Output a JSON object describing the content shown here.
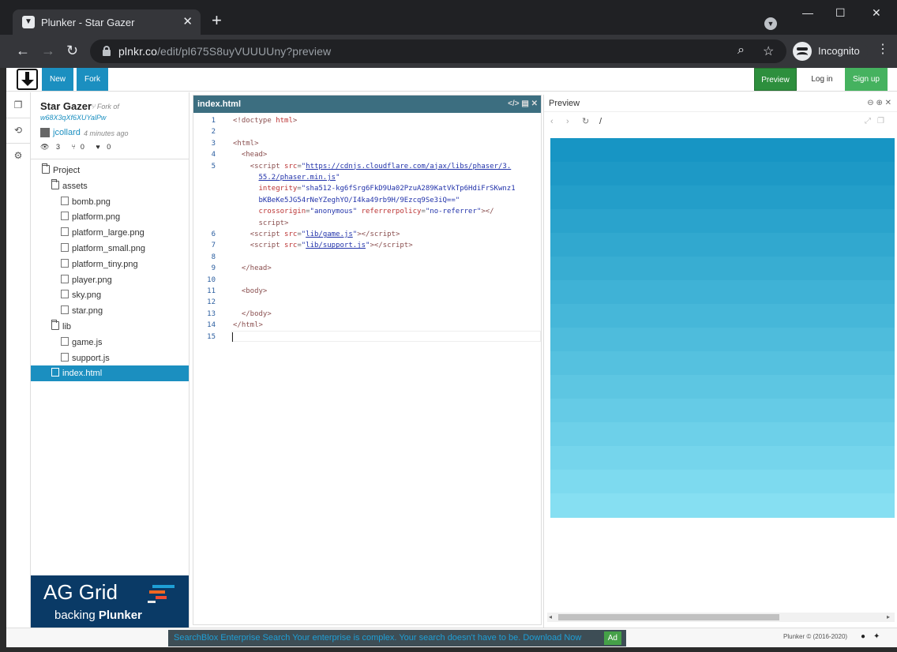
{
  "browser": {
    "tab_title": "Plunker - Star Gazer",
    "tab_close": "✕",
    "new_tab": "+",
    "url_host": "plnkr.co",
    "url_path": "/edit/pl675S8uyVUUUUny?preview",
    "profile_label": "Incognito",
    "win_min": "—",
    "win_max": "☐",
    "win_close": "✕"
  },
  "toolbar": {
    "new_label": "New",
    "fork_label": "Fork",
    "preview_label": "Preview",
    "login_label": "Log in",
    "signup_label": "Sign up"
  },
  "plunk": {
    "title": "Star Gazer",
    "fork_of": "Fork of",
    "fork_id": "w68X3qXf6XUYalPw",
    "user": "jcollard",
    "time": "4 minutes ago",
    "views": "3",
    "forks": "0",
    "stars": "0"
  },
  "tree": [
    {
      "label": "Project",
      "type": "folder",
      "depth": 0
    },
    {
      "label": "assets",
      "type": "folder",
      "depth": 1
    },
    {
      "label": "bomb.png",
      "type": "file",
      "depth": 2
    },
    {
      "label": "platform.png",
      "type": "file",
      "depth": 2
    },
    {
      "label": "platform_large.png",
      "type": "file",
      "depth": 2
    },
    {
      "label": "platform_small.png",
      "type": "file",
      "depth": 2
    },
    {
      "label": "platform_tiny.png",
      "type": "file",
      "depth": 2
    },
    {
      "label": "player.png",
      "type": "file",
      "depth": 2
    },
    {
      "label": "sky.png",
      "type": "file",
      "depth": 2
    },
    {
      "label": "star.png",
      "type": "file",
      "depth": 2
    },
    {
      "label": "lib",
      "type": "folder",
      "depth": 1
    },
    {
      "label": "game.js",
      "type": "file",
      "depth": 2
    },
    {
      "label": "support.js",
      "type": "file",
      "depth": 2
    },
    {
      "label": "index.html",
      "type": "file",
      "depth": 1,
      "active": true
    }
  ],
  "ad": {
    "title": "AG Grid",
    "sub_prefix": "backing",
    "sub_brand": "Plunker"
  },
  "editor": {
    "filename": "index.html",
    "lines": [
      {
        "n": "1",
        "html": "<span class=\"tag\">&lt;!doctype</span> <span class=\"attr\">html</span><span class=\"tag\">&gt;</span>"
      },
      {
        "n": "2",
        "html": ""
      },
      {
        "n": "3",
        "html": "<span class=\"tag\">&lt;html&gt;</span>"
      },
      {
        "n": "4",
        "html": "  <span class=\"tag\">&lt;head&gt;</span>"
      },
      {
        "n": "5",
        "html": "    <span class=\"tag\">&lt;script</span> <span class=\"attr\">src</span>=<span class=\"str\">\"</span><span class=\"url-str\">https://cdnjs.cloudflare.com/ajax/libs/phaser/3.</span>"
      },
      {
        "n": "",
        "html": "      <span class=\"url-str\">55.2/phaser.min.js</span><span class=\"str\">\"</span>"
      },
      {
        "n": "",
        "html": "      <span class=\"attr\">integrity</span>=<span class=\"str\">\"sha512-kg6fSrg6FkD9Ua02PzuA289KatVkTp6HdiFrSKwnz1</span>"
      },
      {
        "n": "",
        "html": "      <span class=\"str\">bKBeKe5JG54rNeYZeghYO/I4ka49rb9H/9Ezcq9Se3iQ==\"</span>"
      },
      {
        "n": "",
        "html": "      <span class=\"attr\">crossorigin</span>=<span class=\"str\">\"anonymous\"</span> <span class=\"attr\">referrerpolicy</span>=<span class=\"str\">\"no-referrer\"</span><span class=\"tag\">&gt;&lt;/</span>"
      },
      {
        "n": "",
        "html": "      <span class=\"tag\">script&gt;</span>"
      },
      {
        "n": "6",
        "html": "    <span class=\"tag\">&lt;script</span> <span class=\"attr\">src</span>=<span class=\"str\">\"</span><span class=\"url-str\">lib/game.js</span><span class=\"str\">\"</span><span class=\"tag\">&gt;&lt;/script&gt;</span>"
      },
      {
        "n": "7",
        "html": "    <span class=\"tag\">&lt;script</span> <span class=\"attr\">src</span>=<span class=\"str\">\"</span><span class=\"url-str\">lib/support.js</span><span class=\"str\">\"</span><span class=\"tag\">&gt;&lt;/script&gt;</span>"
      },
      {
        "n": "8",
        "html": ""
      },
      {
        "n": "9",
        "html": "  <span class=\"tag\">&lt;/head&gt;</span>"
      },
      {
        "n": "10",
        "html": ""
      },
      {
        "n": "11",
        "html": "  <span class=\"tag\">&lt;body&gt;</span>"
      },
      {
        "n": "12",
        "html": ""
      },
      {
        "n": "13",
        "html": "  <span class=\"tag\">&lt;/body&gt;</span>"
      },
      {
        "n": "14",
        "html": "<span class=\"tag\">&lt;/html&gt;</span>"
      },
      {
        "n": "15",
        "html": ""
      }
    ]
  },
  "preview": {
    "title": "Preview",
    "path": "/",
    "sky_colors": [
      "#1795c4",
      "#1d99c6",
      "#239ec9",
      "#2aa3cc",
      "#31a8cf",
      "#38add2",
      "#3fb2d6",
      "#46b7d9",
      "#4ebcdc",
      "#55c1df",
      "#5dc6e2",
      "#65cbe6",
      "#6dd0e9",
      "#75d5ec",
      "#7ddaef",
      "#86dff2"
    ]
  },
  "footer": {
    "ad_text": "SearchBlox Enterprise Search Your enterprise is complex. Your search doesn't have to be. Download Now",
    "ad_badge": "Ad",
    "copyright": "Plunker © (2016-2020)"
  }
}
